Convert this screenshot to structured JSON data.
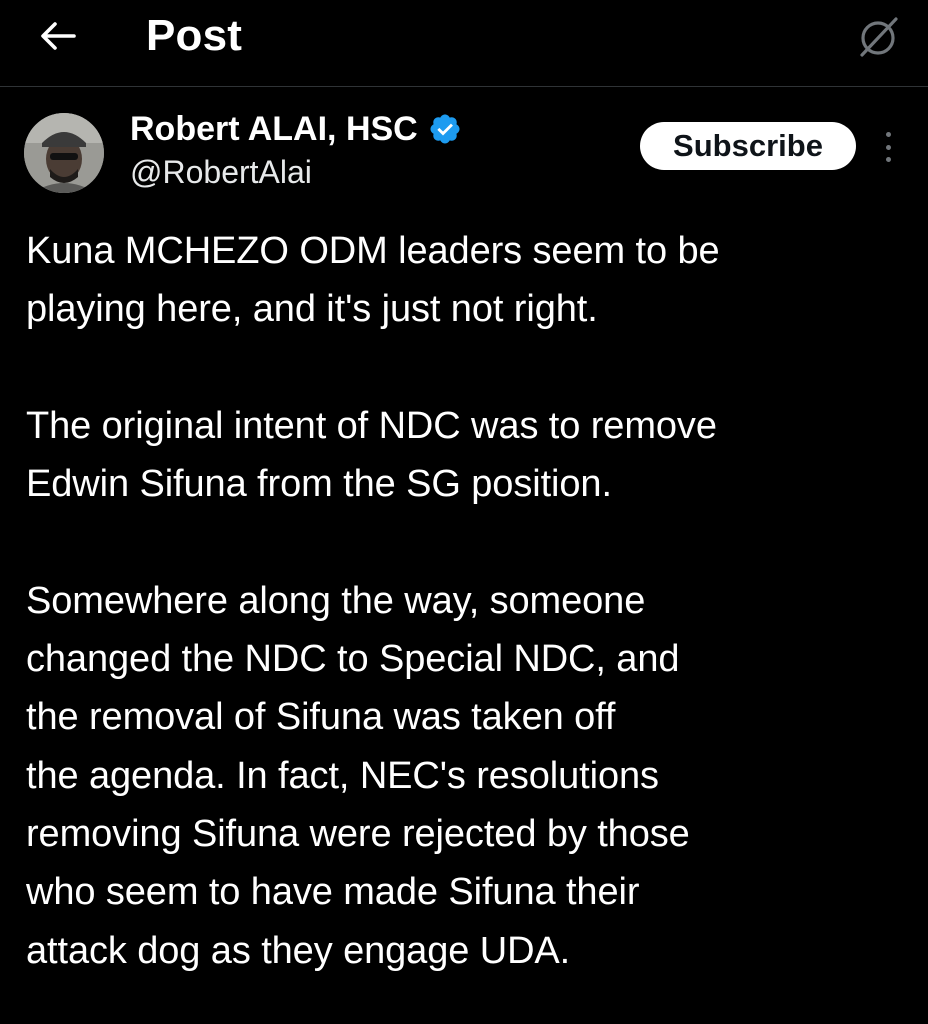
{
  "header": {
    "title": "Post",
    "back_icon": "arrow-left-icon",
    "right_icon": "grok-icon"
  },
  "author": {
    "name": "Robert ALAI, HSC",
    "handle": "@RobertAlai",
    "verified_icon": "verified-badge-icon",
    "verified_color": "#1d9bf0"
  },
  "actions": {
    "subscribe_label": "Subscribe",
    "more_icon": "more-vertical-icon"
  },
  "tweet": {
    "paragraphs": [
      "Kuna MCHEZO ODM leaders seem to be\nplaying here, and it's just not right.",
      "The original intent of NDC was to remove\nEdwin Sifuna from the SG position.",
      "Somewhere along the way, someone\nchanged the NDC to Special NDC, and\nthe removal of Sifuna was taken off\nthe agenda. In fact, NEC's resolutions\nremoving Sifuna were rejected by those\nwho seem to have made Sifuna their\nattack dog as they engage UDA."
    ]
  },
  "colors": {
    "background": "#000000",
    "text": "#ffffff",
    "secondary_text": "#e7e9ea",
    "divider": "#2f3336",
    "button_bg": "#ffffff",
    "button_text": "#0f1419"
  }
}
